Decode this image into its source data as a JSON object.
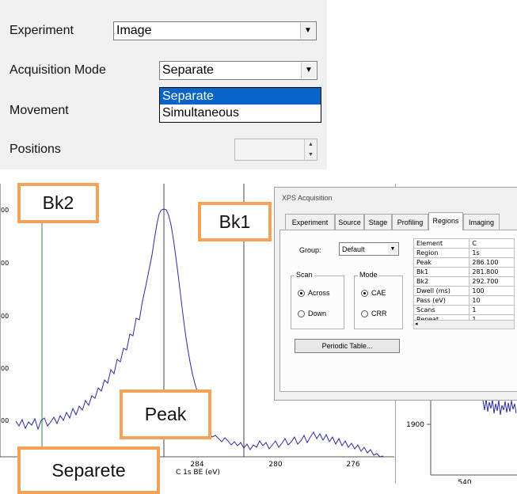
{
  "settings": {
    "experiment_label": "Experiment",
    "experiment_value": "Image",
    "acq_mode_label": "Acquisition Mode",
    "acq_mode_value": "Separate",
    "acq_mode_options": [
      "Separate",
      "Simultaneous"
    ],
    "movement_label": "Movement",
    "positions_label": "Positions"
  },
  "spectrum": {
    "x_ticks": [
      "284",
      "280",
      "276"
    ],
    "x_axis_label": "C 1s  BE (eV)"
  },
  "dialog": {
    "title": "XPS Acquisition",
    "tabs": [
      "Experiment",
      "Source",
      "Stage",
      "Profiling",
      "Regions",
      "Imaging"
    ],
    "active_tab": "Regions",
    "group_label": "Group:",
    "group_value": "Default",
    "scan": {
      "title": "Scan",
      "options": [
        "Across",
        "Down"
      ],
      "selected": "Across"
    },
    "mode": {
      "title": "Mode",
      "options": [
        "CAE",
        "CRR"
      ],
      "selected": "CAE"
    },
    "periodic_table_button": "Periodic Table...",
    "table_rows": [
      [
        "Element",
        "C"
      ],
      [
        "Region",
        "1s"
      ],
      [
        "Peak",
        "286.100"
      ],
      [
        "Bk1",
        "281.800"
      ],
      [
        "Bk2",
        "292.700"
      ],
      [
        "Dwell (ms)",
        "100"
      ],
      [
        "Pass (eV)",
        "10"
      ],
      [
        "Scans",
        "1"
      ],
      [
        "Repeat",
        "1"
      ]
    ]
  },
  "right_plot": {
    "y_tick": "1900",
    "x_tick": "540"
  },
  "annotations": {
    "bk2": "Bk2",
    "bk1": "Bk1",
    "peak": "Peak",
    "separete": "Separete"
  },
  "colors": {
    "annotation_border": "#f4a257",
    "spectrum_line": "#2b2ba0",
    "selection": "#0a64c8",
    "bk2_line": "#2e8b2e"
  }
}
